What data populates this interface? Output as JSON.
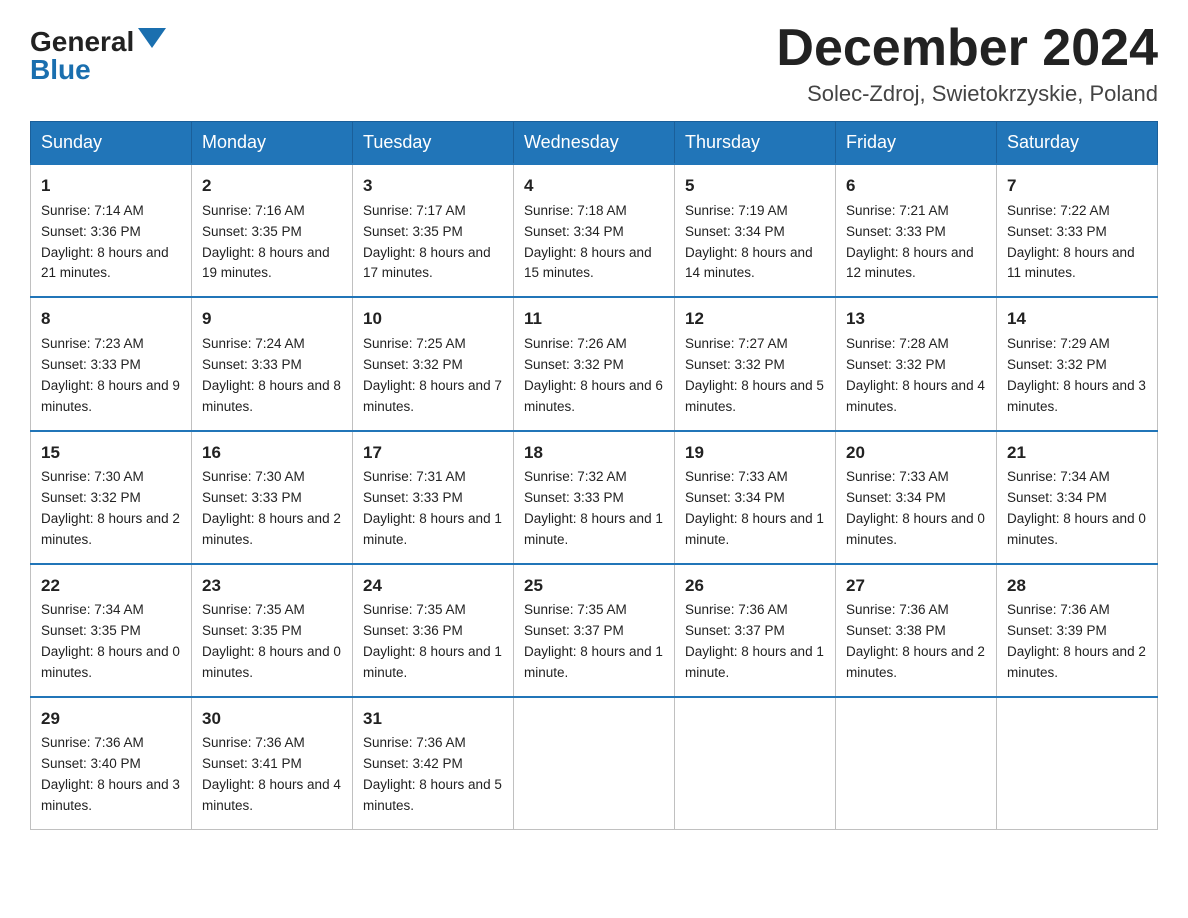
{
  "logo": {
    "general": "General",
    "blue": "Blue"
  },
  "header": {
    "title": "December 2024",
    "location": "Solec-Zdroj, Swietokrzyskie, Poland"
  },
  "weekdays": [
    "Sunday",
    "Monday",
    "Tuesday",
    "Wednesday",
    "Thursday",
    "Friday",
    "Saturday"
  ],
  "weeks": [
    [
      {
        "day": "1",
        "sunrise": "7:14 AM",
        "sunset": "3:36 PM",
        "daylight": "8 hours and 21 minutes."
      },
      {
        "day": "2",
        "sunrise": "7:16 AM",
        "sunset": "3:35 PM",
        "daylight": "8 hours and 19 minutes."
      },
      {
        "day": "3",
        "sunrise": "7:17 AM",
        "sunset": "3:35 PM",
        "daylight": "8 hours and 17 minutes."
      },
      {
        "day": "4",
        "sunrise": "7:18 AM",
        "sunset": "3:34 PM",
        "daylight": "8 hours and 15 minutes."
      },
      {
        "day": "5",
        "sunrise": "7:19 AM",
        "sunset": "3:34 PM",
        "daylight": "8 hours and 14 minutes."
      },
      {
        "day": "6",
        "sunrise": "7:21 AM",
        "sunset": "3:33 PM",
        "daylight": "8 hours and 12 minutes."
      },
      {
        "day": "7",
        "sunrise": "7:22 AM",
        "sunset": "3:33 PM",
        "daylight": "8 hours and 11 minutes."
      }
    ],
    [
      {
        "day": "8",
        "sunrise": "7:23 AM",
        "sunset": "3:33 PM",
        "daylight": "8 hours and 9 minutes."
      },
      {
        "day": "9",
        "sunrise": "7:24 AM",
        "sunset": "3:33 PM",
        "daylight": "8 hours and 8 minutes."
      },
      {
        "day": "10",
        "sunrise": "7:25 AM",
        "sunset": "3:32 PM",
        "daylight": "8 hours and 7 minutes."
      },
      {
        "day": "11",
        "sunrise": "7:26 AM",
        "sunset": "3:32 PM",
        "daylight": "8 hours and 6 minutes."
      },
      {
        "day": "12",
        "sunrise": "7:27 AM",
        "sunset": "3:32 PM",
        "daylight": "8 hours and 5 minutes."
      },
      {
        "day": "13",
        "sunrise": "7:28 AM",
        "sunset": "3:32 PM",
        "daylight": "8 hours and 4 minutes."
      },
      {
        "day": "14",
        "sunrise": "7:29 AM",
        "sunset": "3:32 PM",
        "daylight": "8 hours and 3 minutes."
      }
    ],
    [
      {
        "day": "15",
        "sunrise": "7:30 AM",
        "sunset": "3:32 PM",
        "daylight": "8 hours and 2 minutes."
      },
      {
        "day": "16",
        "sunrise": "7:30 AM",
        "sunset": "3:33 PM",
        "daylight": "8 hours and 2 minutes."
      },
      {
        "day": "17",
        "sunrise": "7:31 AM",
        "sunset": "3:33 PM",
        "daylight": "8 hours and 1 minute."
      },
      {
        "day": "18",
        "sunrise": "7:32 AM",
        "sunset": "3:33 PM",
        "daylight": "8 hours and 1 minute."
      },
      {
        "day": "19",
        "sunrise": "7:33 AM",
        "sunset": "3:34 PM",
        "daylight": "8 hours and 1 minute."
      },
      {
        "day": "20",
        "sunrise": "7:33 AM",
        "sunset": "3:34 PM",
        "daylight": "8 hours and 0 minutes."
      },
      {
        "day": "21",
        "sunrise": "7:34 AM",
        "sunset": "3:34 PM",
        "daylight": "8 hours and 0 minutes."
      }
    ],
    [
      {
        "day": "22",
        "sunrise": "7:34 AM",
        "sunset": "3:35 PM",
        "daylight": "8 hours and 0 minutes."
      },
      {
        "day": "23",
        "sunrise": "7:35 AM",
        "sunset": "3:35 PM",
        "daylight": "8 hours and 0 minutes."
      },
      {
        "day": "24",
        "sunrise": "7:35 AM",
        "sunset": "3:36 PM",
        "daylight": "8 hours and 1 minute."
      },
      {
        "day": "25",
        "sunrise": "7:35 AM",
        "sunset": "3:37 PM",
        "daylight": "8 hours and 1 minute."
      },
      {
        "day": "26",
        "sunrise": "7:36 AM",
        "sunset": "3:37 PM",
        "daylight": "8 hours and 1 minute."
      },
      {
        "day": "27",
        "sunrise": "7:36 AM",
        "sunset": "3:38 PM",
        "daylight": "8 hours and 2 minutes."
      },
      {
        "day": "28",
        "sunrise": "7:36 AM",
        "sunset": "3:39 PM",
        "daylight": "8 hours and 2 minutes."
      }
    ],
    [
      {
        "day": "29",
        "sunrise": "7:36 AM",
        "sunset": "3:40 PM",
        "daylight": "8 hours and 3 minutes."
      },
      {
        "day": "30",
        "sunrise": "7:36 AM",
        "sunset": "3:41 PM",
        "daylight": "8 hours and 4 minutes."
      },
      {
        "day": "31",
        "sunrise": "7:36 AM",
        "sunset": "3:42 PM",
        "daylight": "8 hours and 5 minutes."
      },
      null,
      null,
      null,
      null
    ]
  ]
}
